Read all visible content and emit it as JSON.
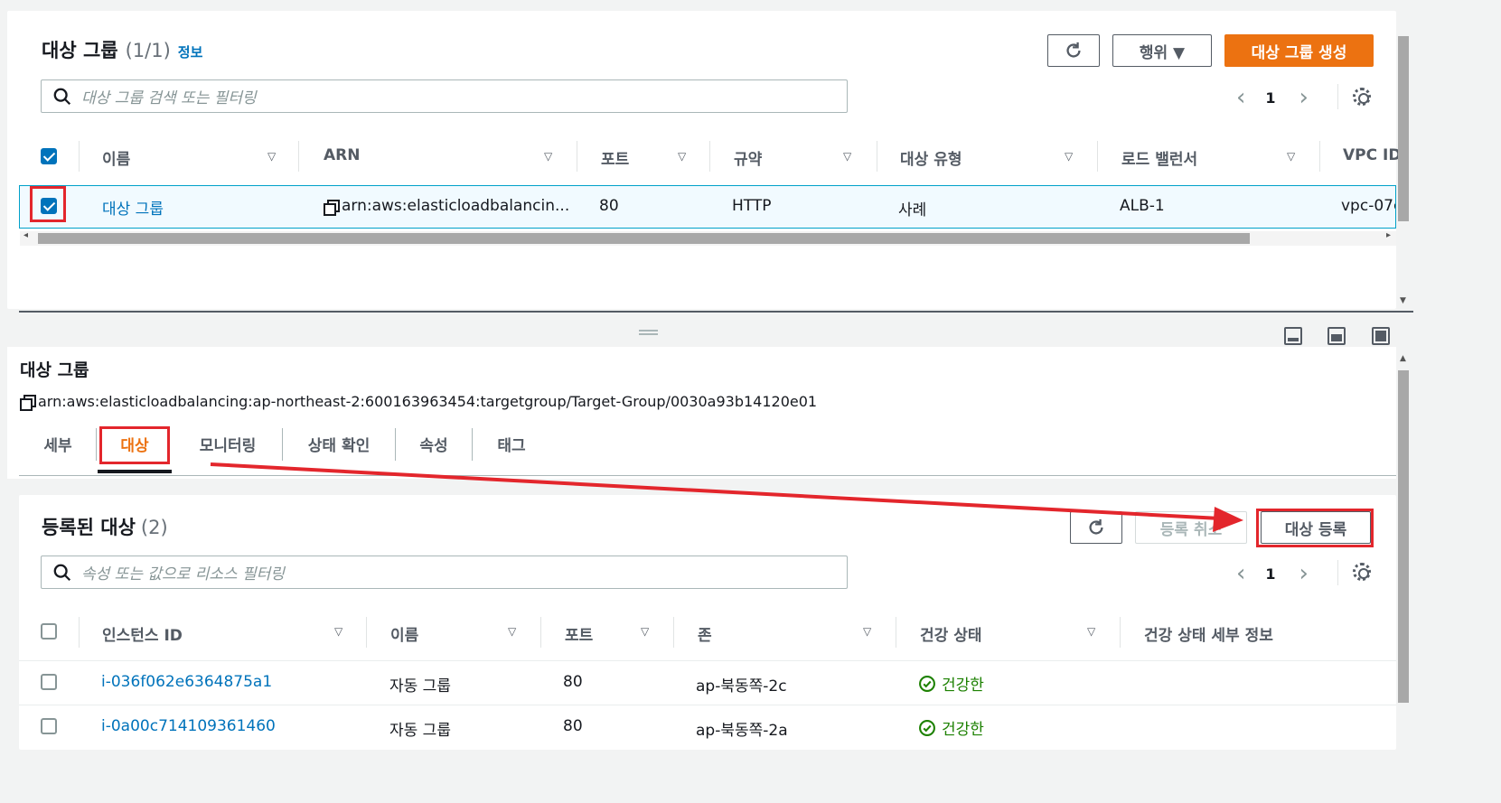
{
  "top": {
    "title": "대상 그룹",
    "count": "(1/1)",
    "info_link": "정보",
    "actions_label": "행위 ▼",
    "create_label": "대상 그룹 생성",
    "search_placeholder": "대상 그룹 검색 또는 필터링",
    "page": "1",
    "columns": [
      "이름",
      "ARN",
      "포트",
      "규약",
      "대상 유형",
      "로드 밸런서",
      "VPC ID"
    ],
    "row": {
      "name": "대상 그룹",
      "arn": "arn:aws:elasticloadbalancin...",
      "port": "80",
      "protocol": "HTTP",
      "target_type": "사례",
      "load_balancer": "ALB-1",
      "vpc": "vpc-07c"
    }
  },
  "detail": {
    "title": "대상 그룹",
    "arn": "arn:aws:elasticloadbalancing:ap-northeast-2:600163963454:targetgroup/Target-Group/0030a93b14120e01",
    "tabs": [
      "세부",
      "대상",
      "모니터링",
      "상태 확인",
      "속성",
      "태그"
    ],
    "active_tab": "대상"
  },
  "registered": {
    "title": "등록된 대상",
    "count": "(2)",
    "deregister_label": "등록 취소",
    "register_label": "대상 등록",
    "search_placeholder": "속성 또는 값으로 리소스 필터링",
    "page": "1",
    "columns": [
      "인스턴스 ID",
      "이름",
      "포트",
      "존",
      "건강 상태",
      "건강 상태 세부 정보"
    ],
    "rows": [
      {
        "id": "i-036f062e6364875a1",
        "name": "자동 그룹",
        "port": "80",
        "zone": "ap-북동쪽-2c",
        "health": "건강한"
      },
      {
        "id": "i-0a00c714109361460",
        "name": "자동 그룹",
        "port": "80",
        "zone": "ap-북동쪽-2a",
        "health": "건강한"
      }
    ]
  },
  "colors": {
    "accent": "#ec7211",
    "link": "#0073bb",
    "healthy": "#1d8102",
    "annotation": "#e3262c"
  }
}
